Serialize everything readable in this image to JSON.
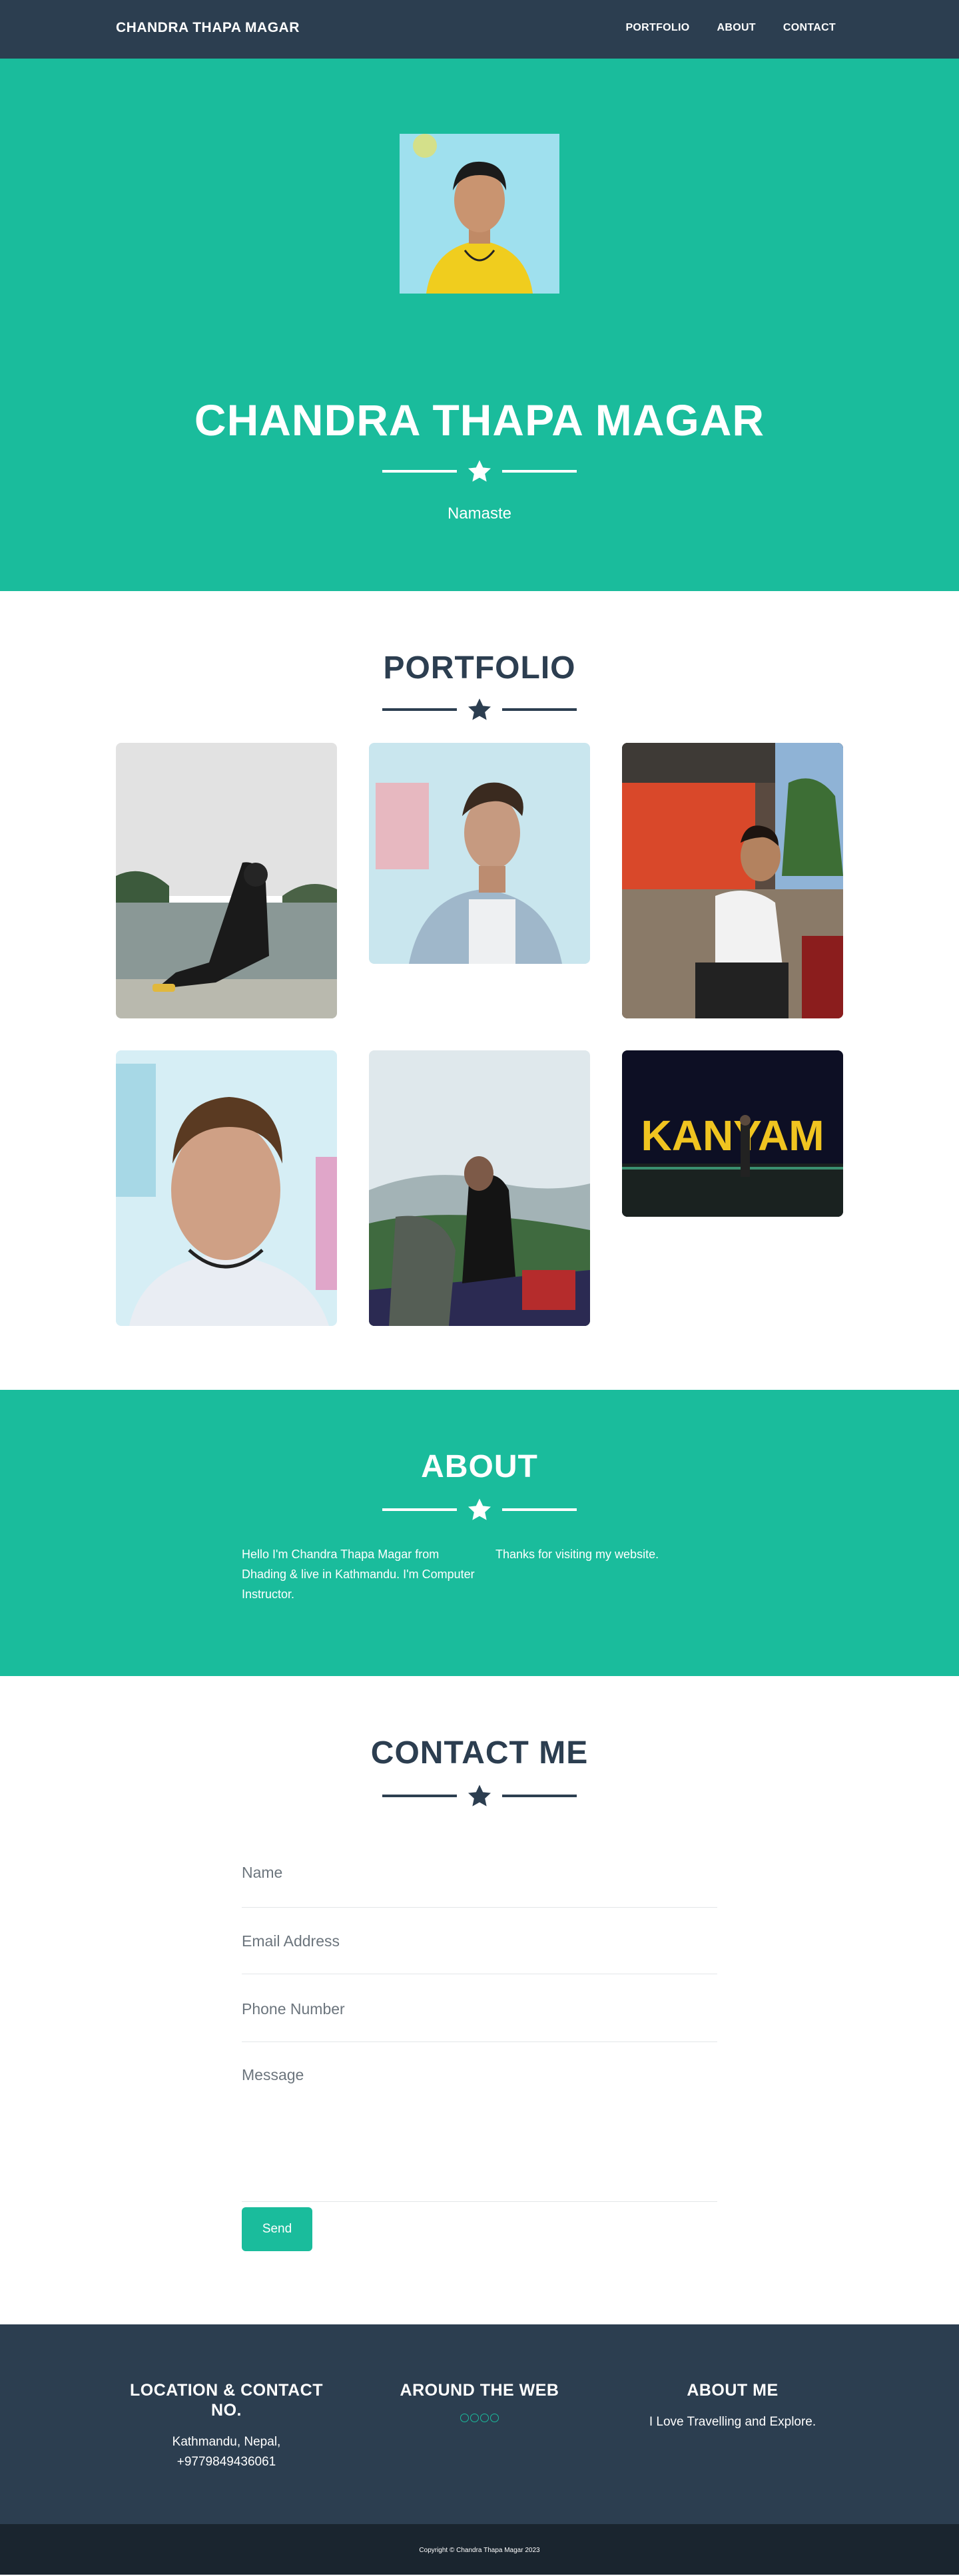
{
  "navbar": {
    "brand": "CHANDRA THAPA MAGAR",
    "links": [
      "PORTFOLIO",
      "ABOUT",
      "CONTACT"
    ]
  },
  "hero": {
    "title": "CHANDRA THAPA MAGAR",
    "subtitle": "Namaste"
  },
  "portfolio": {
    "title": "PORTFOLIO"
  },
  "about": {
    "title": "ABOUT",
    "left_text": "Hello I'm Chandra Thapa Magar from Dhading & live in Kathmandu. I'm Computer Instructor.",
    "right_text": "Thanks for visiting my website."
  },
  "contact": {
    "title": "CONTACT ME",
    "name_placeholder": "Name",
    "email_placeholder": "Email Address",
    "phone_placeholder": "Phone Number",
    "message_placeholder": "Message",
    "send_label": "Send"
  },
  "footer": {
    "location_title": "LOCATION & CONTACT NO.",
    "location_line1": "Kathmandu, Nepal,",
    "location_line2": "+9779849436061",
    "web_title": "AROUND THE WEB",
    "about_title": "ABOUT ME",
    "about_text": "I Love Travelling and Explore.",
    "copyright": "Copyright © Chandra Thapa Magar 2023"
  },
  "tile_text": {
    "kanyam": "KANYAM"
  },
  "colors": {
    "primary": "#2c3e50",
    "accent": "#1abc9c",
    "dark": "#1a252f"
  }
}
